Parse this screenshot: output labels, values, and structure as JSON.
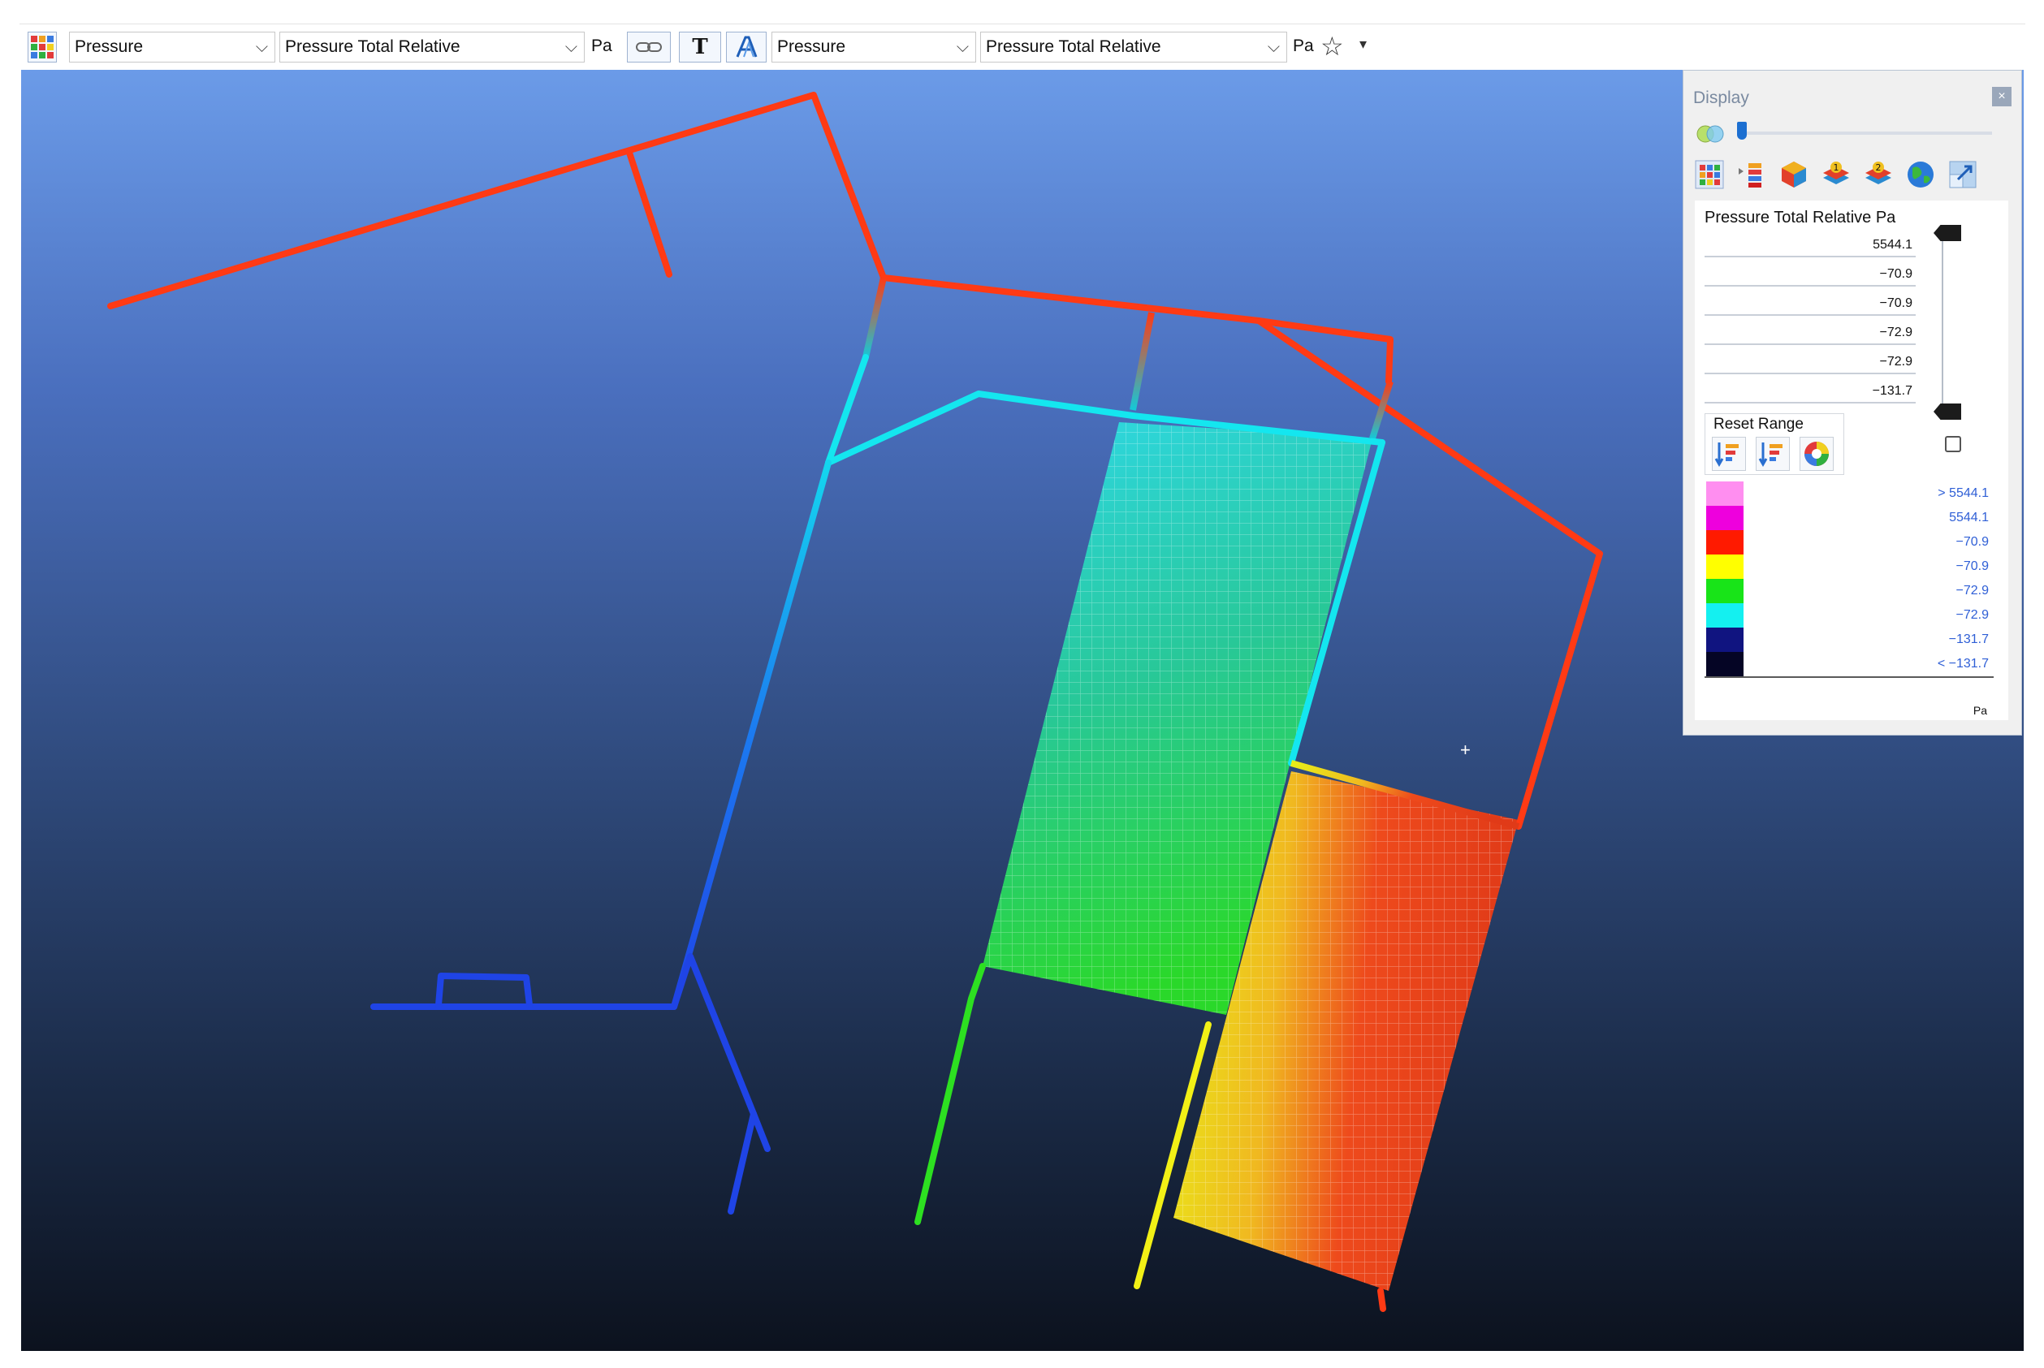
{
  "toolbar": {
    "left": {
      "category": "Pressure",
      "variable": "Pressure Total Relative",
      "unit": "Pa"
    },
    "right": {
      "category": "Pressure",
      "variable": "Pressure Total Relative",
      "unit": "Pa"
    },
    "text_button_glyph": "T",
    "favorite_glyph": "☆",
    "menu_glyph": "▾"
  },
  "display_panel": {
    "title": "Display",
    "close_glyph": "×",
    "range_title": "Pressure Total Relative Pa",
    "range_values": [
      "5544.1",
      "−70.9",
      "−70.9",
      "−72.9",
      "−72.9",
      "−131.7"
    ],
    "reset_label": "Reset Range",
    "legend": [
      {
        "label": "> 5544.1",
        "color": "#ff8ef0"
      },
      {
        "label": "5544.1",
        "color": "#ee00dd"
      },
      {
        "label": "−70.9",
        "color": "#ff1a00"
      },
      {
        "label": "−70.9",
        "color": "#ffff00"
      },
      {
        "label": "−72.9",
        "color": "#18e418"
      },
      {
        "label": "−72.9",
        "color": "#14f0f0"
      },
      {
        "label": "−131.7",
        "color": "#101480"
      },
      {
        "label": "< −131.7",
        "color": "#050525"
      }
    ],
    "legend_unit": "Pa",
    "icons": [
      "grid-view-icon",
      "legend-bars-icon",
      "cube-icon",
      "layer-1-icon",
      "layer-2-icon",
      "globe-icon",
      "resize-icon"
    ]
  },
  "colors": {
    "high": "#ff3a14",
    "cyan": "#14e6ef",
    "blue": "#1f54e6",
    "green": "#2de021",
    "yellow": "#f2f016"
  }
}
